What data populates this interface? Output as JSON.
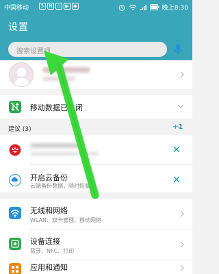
{
  "status_bar": {
    "carrier": "中国移动",
    "app_icons": [
      "5",
      "N",
      "◇",
      "▶",
      "◆"
    ],
    "right_text": "晚上8:30",
    "battery_icon": "battery-icon",
    "wifi_icon": "wifi-icon"
  },
  "header": {
    "title": "设置",
    "search_placeholder": "搜索设置项",
    "mic_icon": "microphone-icon",
    "bg_color": "#3aa6b9"
  },
  "account": {
    "avatar_icon": "user-avatar-icon"
  },
  "mobile_data": {
    "icon": "mobile-data-icon",
    "label": "移动数据已关闭"
  },
  "suggestions": {
    "label": "建议 (3)",
    "count": "+1",
    "items": [
      {
        "icon": "huawei-logo-icon",
        "title": "",
        "subtitle": ""
      },
      {
        "icon": "cloud-backup-icon",
        "title": "开启云备份",
        "subtitle": "云端备份数据，随时恢复"
      }
    ]
  },
  "settings": [
    {
      "icon": "wifi-network-icon",
      "title": "无线和网络",
      "subtitle": "WLAN、双卡管理、移动网络"
    },
    {
      "icon": "device-connect-icon",
      "title": "设备连接",
      "subtitle": "蓝牙、NFC、打印"
    },
    {
      "icon": "apps-notifications-icon",
      "title": "应用和通知",
      "subtitle": ""
    }
  ],
  "annotation": {
    "arrow_color": "#3cd83c"
  }
}
